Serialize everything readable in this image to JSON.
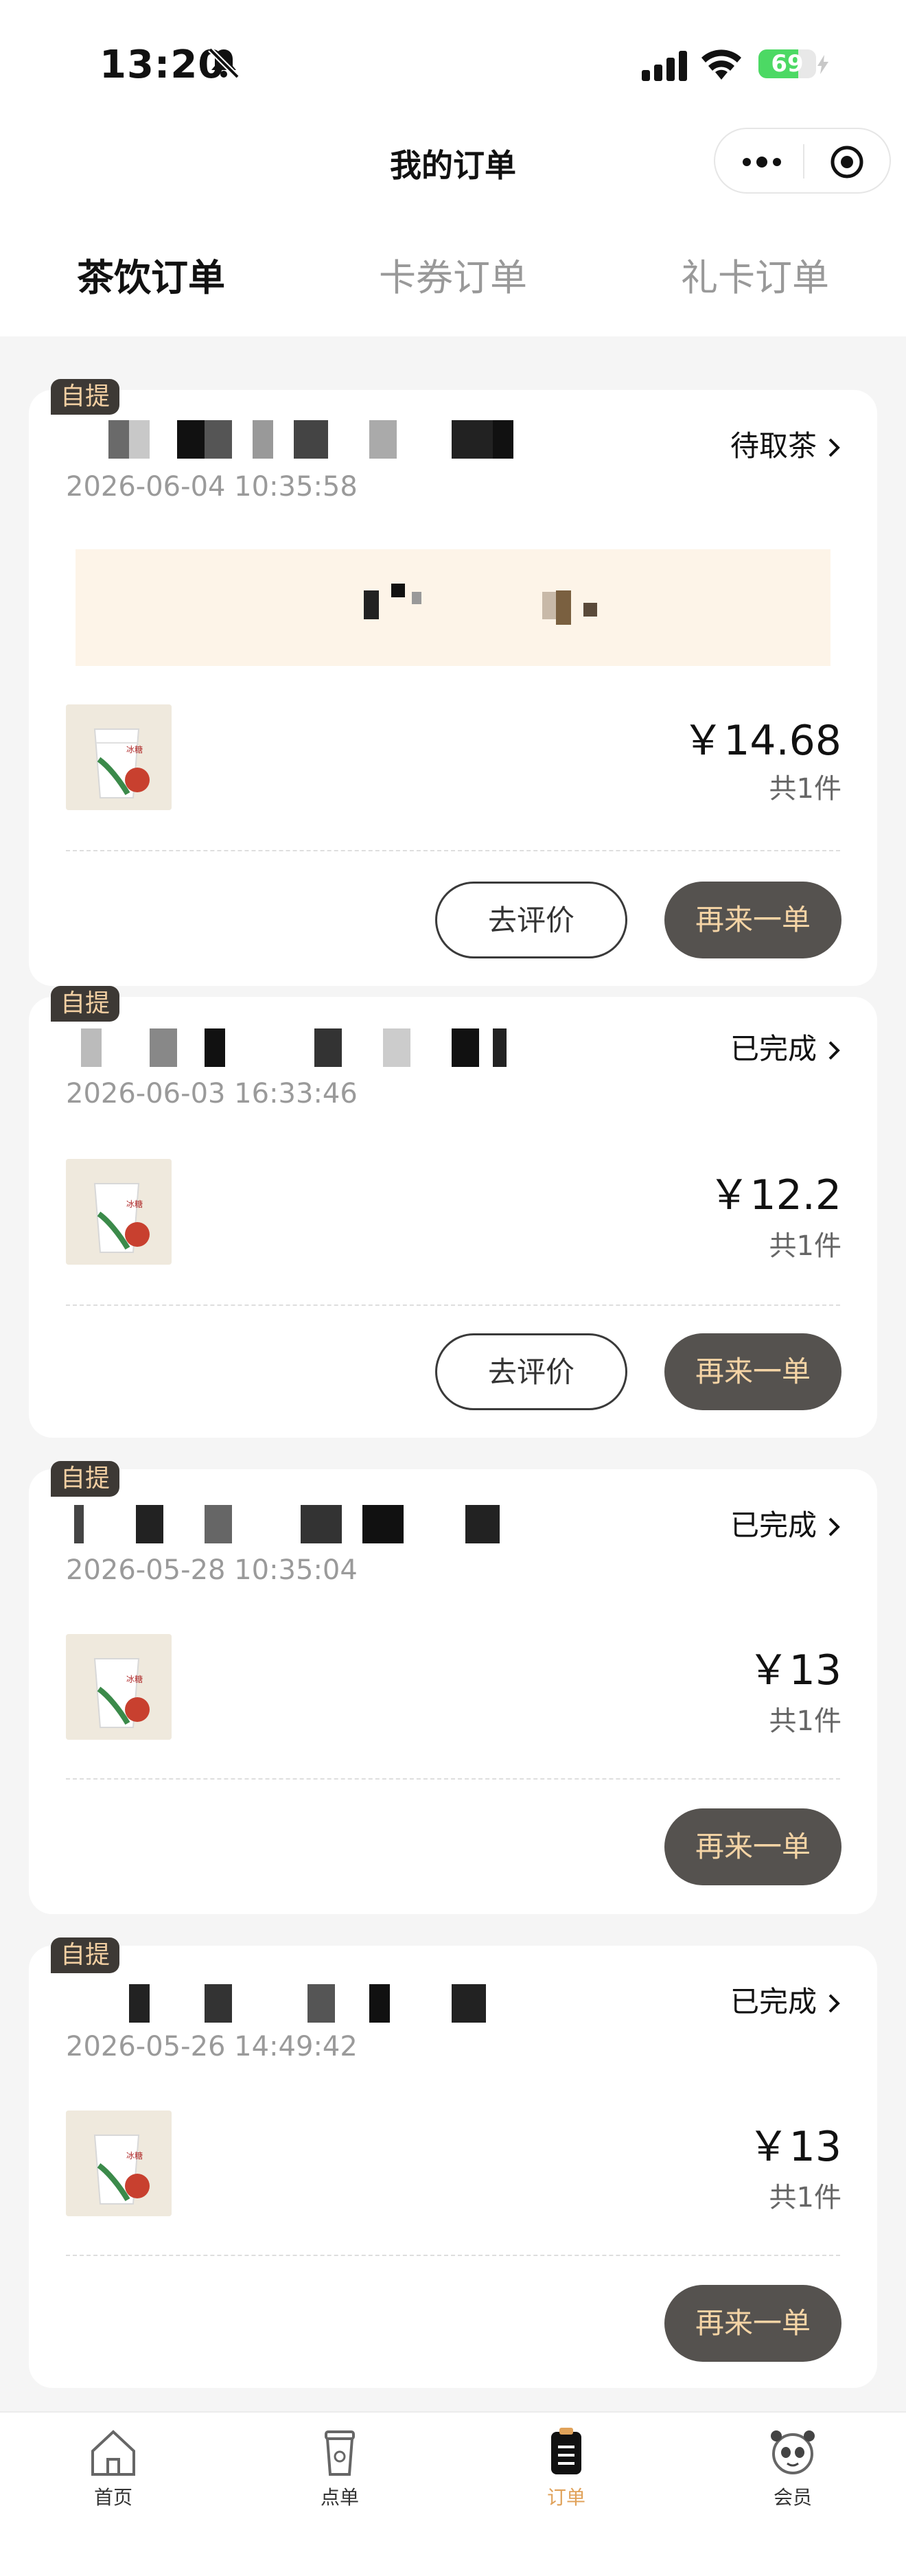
{
  "status_bar": {
    "time": "13:20",
    "battery": "69",
    "battery_level": 0.69
  },
  "header": {
    "title": "我的订单"
  },
  "tabs": [
    {
      "label": "茶饮订单",
      "active": true
    },
    {
      "label": "卡券订单",
      "active": false
    },
    {
      "label": "礼卡订单",
      "active": false
    }
  ],
  "orders": [
    {
      "badge": "自提",
      "status": "待取茶",
      "time": "2026-06-04 10:35:58",
      "price": "￥14.68",
      "quantity": "共1件",
      "buttons": [
        "去评价",
        "再来一单"
      ],
      "has_pickup_code": true
    },
    {
      "badge": "自提",
      "status": "已完成",
      "time": "2026-06-03 16:33:46",
      "price": "￥12.2",
      "quantity": "共1件",
      "buttons": [
        "去评价",
        "再来一单"
      ]
    },
    {
      "badge": "自提",
      "status": "已完成",
      "time": "2026-05-28 10:35:04",
      "price": "￥13",
      "quantity": "共1件",
      "buttons": [
        "再来一单"
      ]
    },
    {
      "badge": "自提",
      "status": "已完成",
      "time": "2026-05-26 14:49:42",
      "price": "￥13",
      "quantity": "共1件",
      "buttons": [
        "再来一单"
      ]
    }
  ],
  "bottom_nav": [
    {
      "label": "首页",
      "icon": "home-icon",
      "active": false
    },
    {
      "label": "点单",
      "icon": "cup-icon",
      "active": false
    },
    {
      "label": "订单",
      "icon": "orders-icon",
      "active": true
    },
    {
      "label": "会员",
      "icon": "member-icon",
      "active": false
    }
  ],
  "colors": {
    "accent": "#e0a25a",
    "badge_bg": "#3d3935",
    "badge_text": "#f2cfa2",
    "dark_button": "#55524f",
    "pickup_bg": "#fdf4e8"
  }
}
